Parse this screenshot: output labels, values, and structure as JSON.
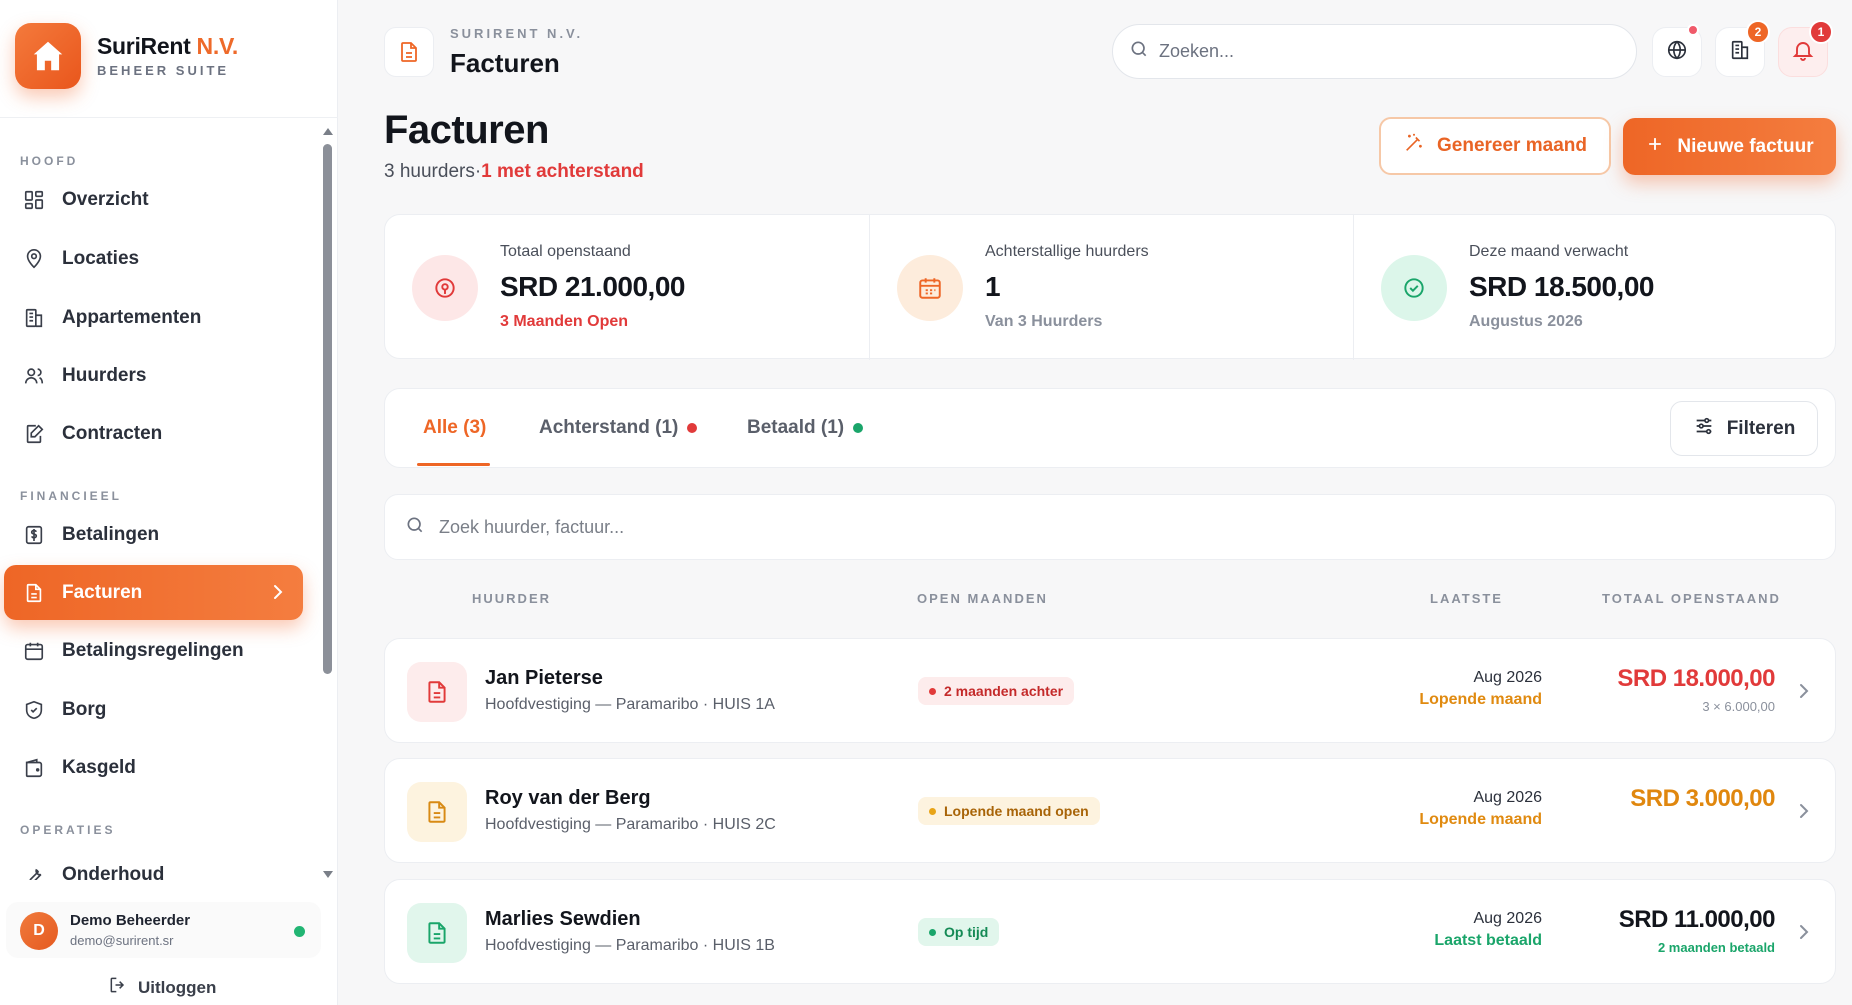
{
  "brand": {
    "name_main": "SuriRent",
    "name_accent": "N.V.",
    "subtitle": "BEHEER SUITE"
  },
  "sidebar": {
    "sections": [
      "HOOFD",
      "FINANCIEEL",
      "OPERATIES"
    ],
    "items": [
      {
        "label": "Overzicht",
        "icon": "dashboard-icon"
      },
      {
        "label": "Locaties",
        "icon": "map-pin-icon"
      },
      {
        "label": "Appartementen",
        "icon": "building-icon"
      },
      {
        "label": "Huurders",
        "icon": "users-icon"
      },
      {
        "label": "Contracten",
        "icon": "contract-edit-icon"
      },
      {
        "label": "Betalingen",
        "icon": "dollar-receipt-icon"
      },
      {
        "label": "Facturen",
        "icon": "invoice-icon"
      },
      {
        "label": "Betalingsregelingen",
        "icon": "calendar-icon"
      },
      {
        "label": "Borg",
        "icon": "shield-icon"
      },
      {
        "label": "Kasgeld",
        "icon": "wallet-icon"
      },
      {
        "label": "Onderhoud",
        "icon": "wrench-icon"
      }
    ],
    "active": "Facturen"
  },
  "user": {
    "initial": "D",
    "name": "Demo Beheerder",
    "email": "demo@surirent.sr",
    "logout": "Uitloggen"
  },
  "topbar": {
    "crumb": "SURIRENT N.V.",
    "title": "Facturen",
    "search_placeholder": "Zoeken...",
    "apartments_badge": "2",
    "notifications_badge": "1"
  },
  "page": {
    "title": "Facturen",
    "subtitle_count": "3 huurders",
    "subtitle_sep": "·",
    "subtitle_alert": "1 met achterstand",
    "btn_generate": "Genereer maand",
    "btn_new": "Nieuwe factuur"
  },
  "stats": [
    {
      "label": "Totaal openstaand",
      "value": "SRD 21.000,00",
      "note": "3 Maanden Open",
      "icon": "money-icon"
    },
    {
      "label": "Achterstallige huurders",
      "value": "1",
      "note": "Van 3 Huurders",
      "icon": "calendar-icon"
    },
    {
      "label": "Deze maand verwacht",
      "value": "SRD 18.500,00",
      "note": "Augustus 2026",
      "icon": "check-circle-icon"
    }
  ],
  "tabs": [
    {
      "label": "Alle (3)"
    },
    {
      "label": "Achterstand (1)"
    },
    {
      "label": "Betaald (1)"
    }
  ],
  "filter_label": "Filteren",
  "table_search_placeholder": "Zoek huurder, factuur...",
  "columns": [
    "HUURDER",
    "OPEN MAANDEN",
    "LAATSTE",
    "TOTAAL OPENSTAAND"
  ],
  "rows": [
    {
      "name": "Jan Pieterse",
      "location": "Hoofdvestiging — Paramaribo · HUIS 1A",
      "status": "2 maanden achter",
      "last_month": "Aug 2026",
      "last_status": "Lopende maand",
      "total": "SRD 18.000,00",
      "detail": "3 × 6.000,00"
    },
    {
      "name": "Roy van der Berg",
      "location": "Hoofdvestiging — Paramaribo · HUIS 2C",
      "status": "Lopende maand open",
      "last_month": "Aug 2026",
      "last_status": "Lopende maand",
      "total": "SRD 3.000,00",
      "detail": ""
    },
    {
      "name": "Marlies Sewdien",
      "location": "Hoofdvestiging — Paramaribo · HUIS 1B",
      "status": "Op tijd",
      "last_month": "Aug 2026",
      "last_status": "Laatst betaald",
      "total": "SRD 11.000,00",
      "detail": "2 maanden betaald"
    }
  ],
  "colors": {
    "accent": "#ee6626",
    "danger": "#e13a3a",
    "warning": "#e08a10",
    "success": "#1aa56a"
  }
}
